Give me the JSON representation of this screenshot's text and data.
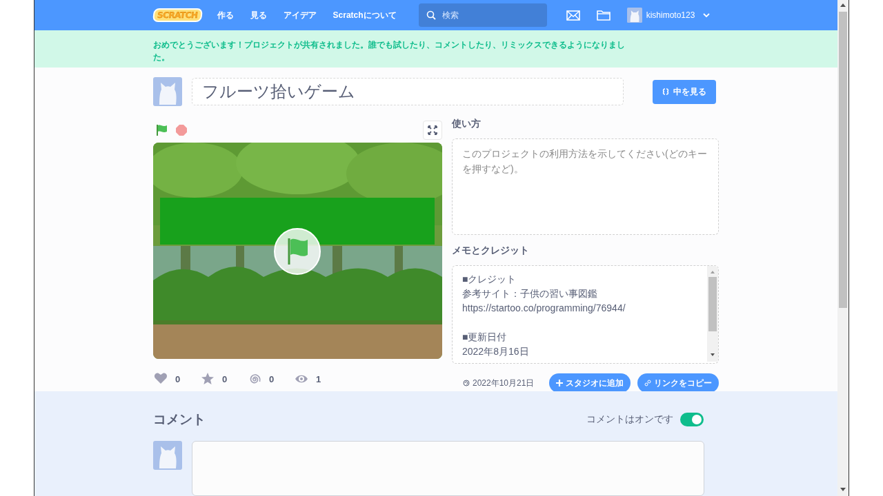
{
  "nav": {
    "logo": "SCRATCH",
    "links": [
      "作る",
      "見る",
      "アイデア",
      "Scratchについて"
    ],
    "search": {
      "placeholder": "検索"
    },
    "username": "kishimoto123"
  },
  "banner": "おめでとうございます！プロジェクトが共有されました。誰でも試したり、コメントしたり、リミックスできるようになりました。",
  "project": {
    "title": "フルーツ拾いゲーム",
    "see_inside": "中を見る"
  },
  "instructions": {
    "heading": "使い方",
    "placeholder": "このプロジェクトの利用方法を示してください(どのキーを押すなど)。"
  },
  "notes": {
    "heading": "メモとクレジット",
    "sections": [
      [
        "■クレジット",
        "参考サイト：子供の習い事図鑑",
        "https://startoo.co/programming/76944/"
      ],
      [
        "■更新日付",
        "2022年8月16日"
      ]
    ]
  },
  "stats": [
    {
      "kind": "love",
      "count": "0"
    },
    {
      "kind": "favorite",
      "count": "0"
    },
    {
      "kind": "remix",
      "count": "0"
    },
    {
      "kind": "view",
      "count": "1"
    }
  ],
  "shared_date": "2022年10月21日",
  "buttons": [
    {
      "kind": "add",
      "label": "スタジオに追加"
    },
    {
      "kind": "link",
      "label": "リンクをコピー"
    }
  ],
  "comments": {
    "heading": "コメント",
    "toggle_label": "コメントはオンです",
    "on": true
  }
}
